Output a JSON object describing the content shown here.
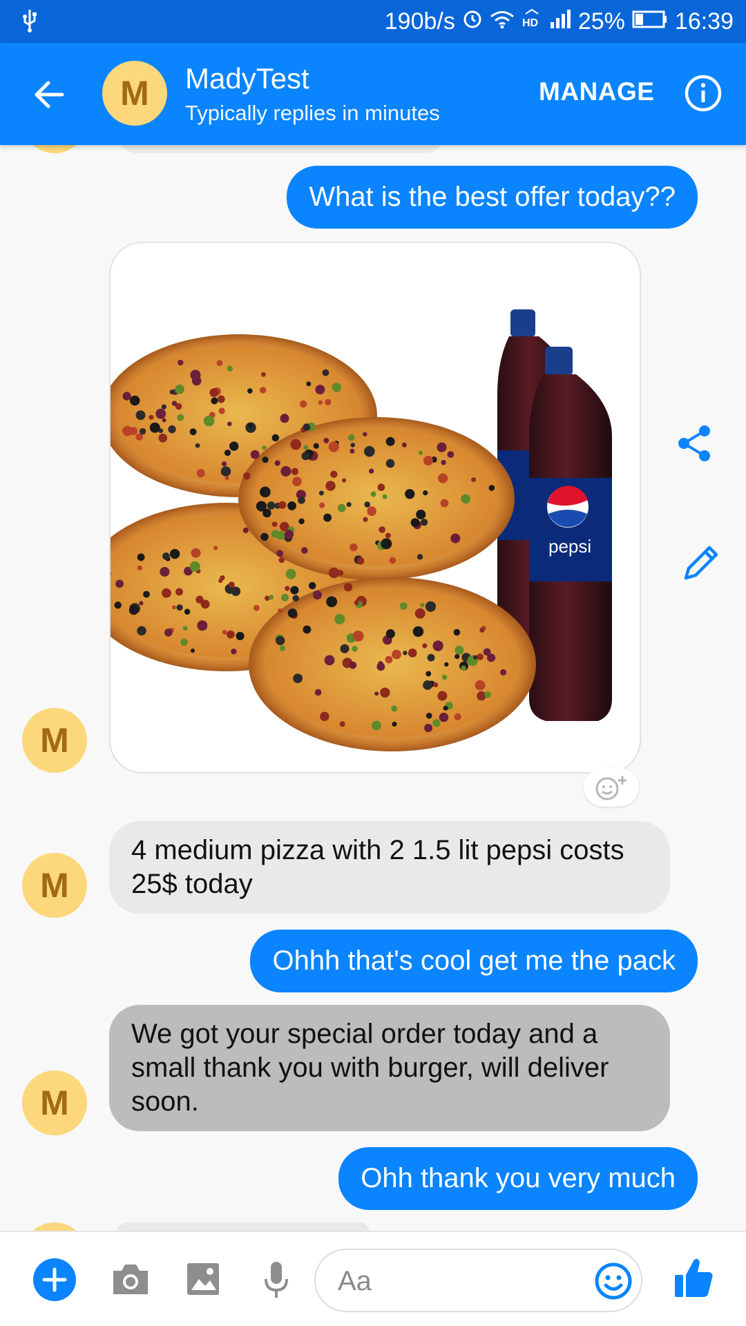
{
  "status_bar": {
    "net_speed": "190b/s",
    "battery": "25%",
    "time": "16:39",
    "icons": [
      "usb-icon",
      "alarm-icon",
      "wifi-icon",
      "hd-icon",
      "signal-icon",
      "battery-icon"
    ]
  },
  "header": {
    "avatar_letter": "M",
    "contact_name": "MadyTest",
    "contact_status": "Typically replies in minutes",
    "manage_label": "MANAGE",
    "icons": [
      "back-arrow-icon",
      "info-icon"
    ]
  },
  "messages": [
    {
      "direction": "outgoing",
      "text": "What is the best offer today??"
    },
    {
      "direction": "incoming",
      "type": "image",
      "image_description_icon": "pizza-pepsi-image"
    },
    {
      "direction": "incoming",
      "text": "4 medium pizza with 2 1.5 lit pepsi costs 25$ today"
    },
    {
      "direction": "outgoing",
      "text": "Ohhh that's cool get me the pack"
    },
    {
      "direction": "incoming",
      "text": "We got your special order today and a small thank you  with burger, will deliver soon."
    },
    {
      "direction": "outgoing",
      "text": "Ohh thank you very much"
    }
  ],
  "avatar_letter": "M",
  "image_overlay": {
    "brand_text": "pepsi"
  },
  "composer": {
    "placeholder": "Aa",
    "icons": [
      "plus-icon",
      "camera-icon",
      "gallery-icon",
      "mic-icon",
      "emoji-icon",
      "thumbs-up-icon"
    ]
  },
  "colors": {
    "accent": "#0a84ff",
    "status_bar": "#0866d8",
    "avatar_bg": "#fdd77c",
    "avatar_fg": "#a26a12",
    "incoming_bubble": "#e9e9e9",
    "incoming_bubble_dark": "#bcbcbc"
  }
}
